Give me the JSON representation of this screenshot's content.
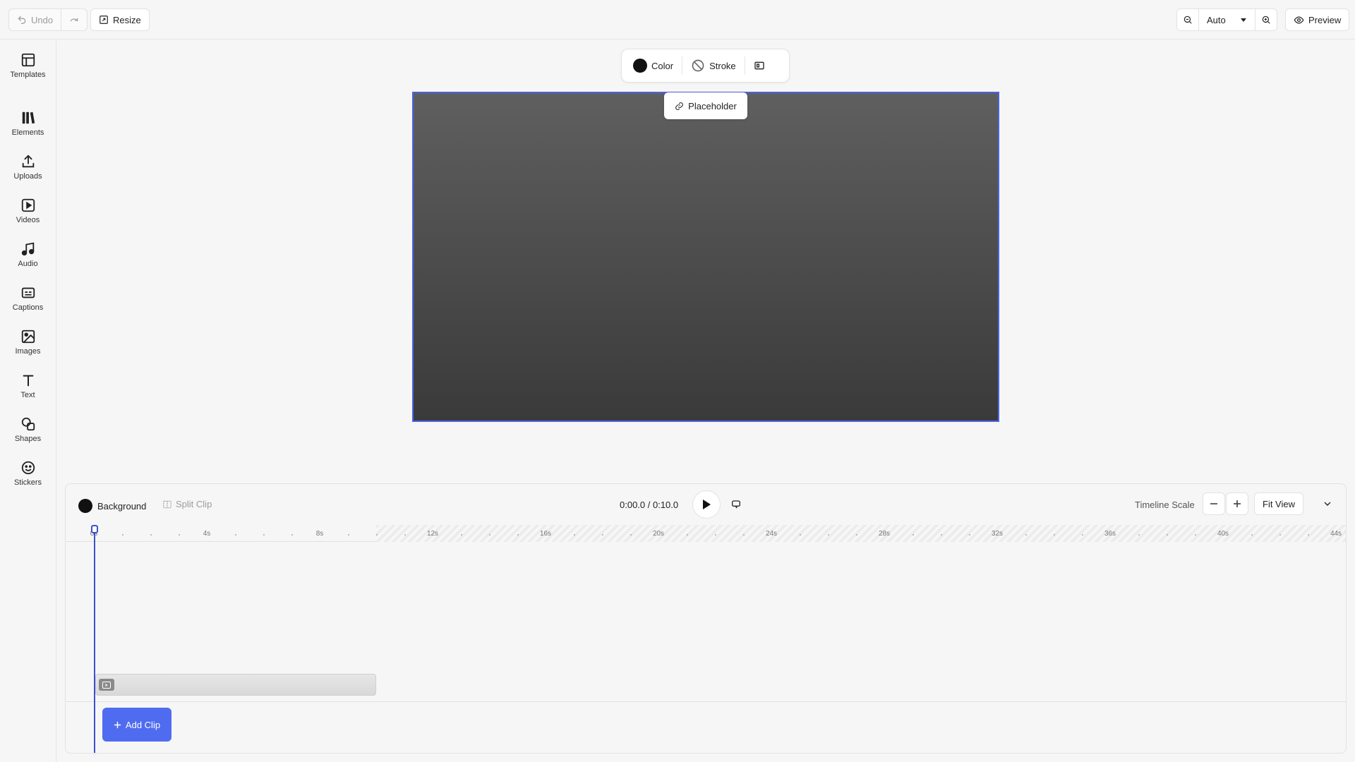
{
  "topbar": {
    "undo_label": "Undo",
    "resize_label": "Resize",
    "zoom_value": "Auto",
    "preview_label": "Preview"
  },
  "sidebar": {
    "items": [
      {
        "label": "Templates",
        "icon": "templates-icon"
      },
      {
        "label": "Elements",
        "icon": "elements-icon"
      },
      {
        "label": "Uploads",
        "icon": "upload-icon"
      },
      {
        "label": "Videos",
        "icon": "video-icon"
      },
      {
        "label": "Audio",
        "icon": "music-note-icon"
      },
      {
        "label": "Captions",
        "icon": "captions-icon"
      },
      {
        "label": "Images",
        "icon": "image-icon"
      },
      {
        "label": "Text",
        "icon": "text-icon"
      },
      {
        "label": "Shapes",
        "icon": "shapes-icon"
      },
      {
        "label": "Stickers",
        "icon": "sticker-icon"
      }
    ]
  },
  "toolbar": {
    "color_label": "Color",
    "stroke_label": "Stroke"
  },
  "canvas": {
    "placeholder_label": "Placeholder",
    "selection_color": "#4a63e6"
  },
  "timeline": {
    "background_label": "Background",
    "split_clip_label": "Split Clip",
    "time_display": "0:00.0 / 0:10.0",
    "scale_label": "Timeline Scale",
    "fit_view_label": "Fit View",
    "add_clip_label": "Add Clip",
    "ruler_ticks": [
      "0s",
      "4s",
      "8s",
      "12s",
      "16s",
      "20s",
      "24s",
      "28s",
      "32s",
      "36s",
      "40s",
      "44s"
    ],
    "accent_color": "#4f6cf0"
  }
}
